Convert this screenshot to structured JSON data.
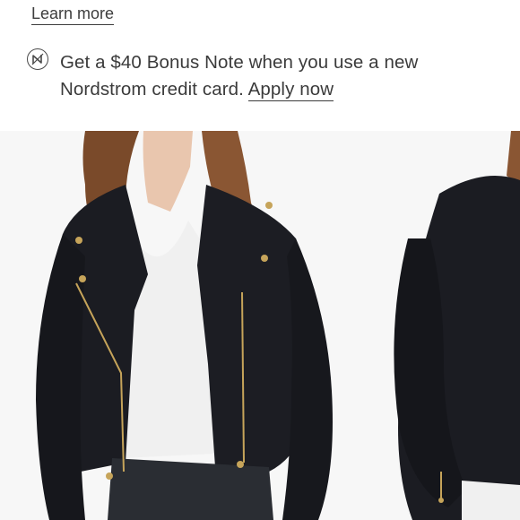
{
  "links": {
    "learn_more": "Learn more"
  },
  "promo": {
    "icon": "nordstrom-n-icon",
    "text": "Get a $40 Bonus Note when you use a new Nordstrom credit card.",
    "apply_label": "Apply now"
  },
  "photos": [
    {
      "icon": "product-photo-front",
      "subject": "black faux leather moto jacket, front view"
    },
    {
      "icon": "product-photo-side",
      "subject": "black faux leather moto jacket, side view"
    }
  ],
  "colors": {
    "text": "#3b3b3b",
    "jacket": "#1a1b20",
    "shirt": "#f2f2f2",
    "hair": "#7a4a2a",
    "hardware": "#c6a45a"
  }
}
